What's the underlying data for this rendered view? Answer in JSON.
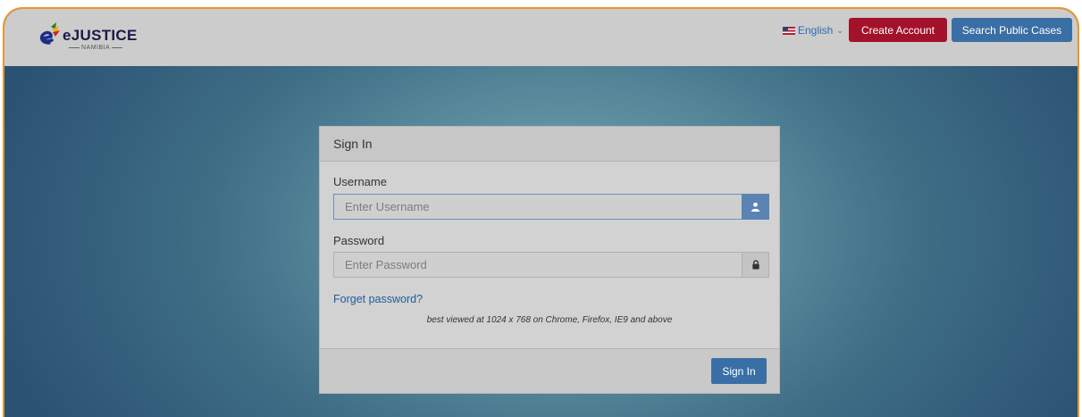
{
  "header": {
    "logo_text": "eJUSTICE",
    "logo_subtext": "NAMIBIA",
    "language": "English",
    "create_account_label": "Create Account",
    "search_cases_label": "Search Public Cases"
  },
  "signin": {
    "title": "Sign In",
    "username_label": "Username",
    "username_placeholder": "Enter Username",
    "username_value": "",
    "password_label": "Password",
    "password_placeholder": "Enter Password",
    "password_value": "",
    "forgot_label": "Forget password?",
    "note": "best viewed at 1024 x 768 on Chrome, Firefox, IE9 and above",
    "submit_label": "Sign In"
  },
  "icons": {
    "user": "user-icon",
    "lock": "lock-icon",
    "flag": "us-flag-icon",
    "caret": "chevron-down-icon"
  },
  "colors": {
    "accent_border": "#e8962e",
    "create_button": "#a3122a",
    "primary_button": "#3a6fa5"
  }
}
